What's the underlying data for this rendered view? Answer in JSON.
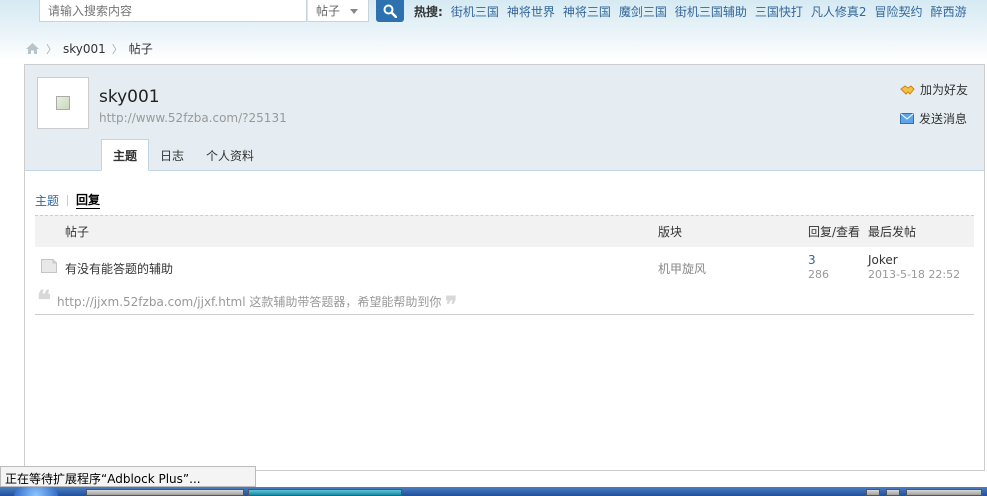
{
  "search": {
    "placeholder": "请输入搜索内容",
    "type_selected": "帖子"
  },
  "hot": {
    "label": "热搜:",
    "items": [
      "街机三国",
      "神将世界",
      "神将三国",
      "魔剑三国",
      "街机三国辅助",
      "三国快打",
      "凡人修真2",
      "冒险契约",
      "醉西游"
    ]
  },
  "breadcrumb": {
    "user": "sky001",
    "current": "帖子"
  },
  "profile": {
    "username": "sky001",
    "url": "http://www.52fzba.com/?25131",
    "add_friend": "加为好友",
    "send_message": "发送消息",
    "tabs": [
      "主题",
      "日志",
      "个人资料"
    ],
    "active_tab": 0
  },
  "subtabs": {
    "topics": "主题",
    "replies": "回复"
  },
  "table": {
    "headers": {
      "post": "帖子",
      "forum": "版块",
      "reply_view": "回复/查看",
      "last_post": "最后发帖"
    },
    "rows": [
      {
        "title": "有没有能答题的辅助",
        "forum": "机甲旋风",
        "replies": "3",
        "views": "286",
        "last_user": "Joker",
        "last_time": "2013-5-18 22:52",
        "quote": "http://jjxm.52fzba.com/jjxf.html 这款辅助带答题器，希望能帮助到你"
      }
    ]
  },
  "status_bar": {
    "text": "正在等待扩展程序“Adblock Plus”..."
  },
  "colors": {
    "accent": "#2d72ae",
    "link": "#336699",
    "profile_bg": "#e5edf2"
  }
}
